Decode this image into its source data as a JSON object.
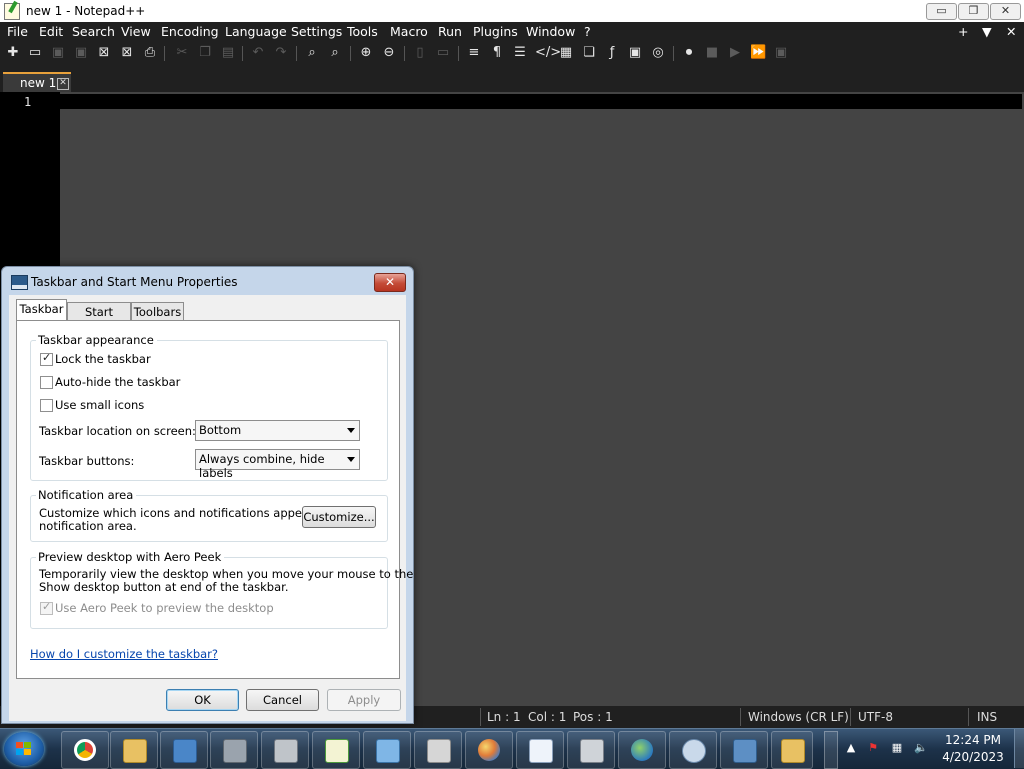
{
  "npp": {
    "title": "new 1 - Notepad++",
    "menu": [
      "File",
      "Edit",
      "Search",
      "View",
      "Encoding",
      "Language",
      "Settings",
      "Tools",
      "Macro",
      "Run",
      "Plugins",
      "Window",
      "?"
    ],
    "menu_right": {
      "plus": "+",
      "down": "▼",
      "close": "✕"
    },
    "window_buttons": {
      "minimize": "▭",
      "maximize": "❐",
      "close": "✕"
    },
    "tab": {
      "label": "new 1",
      "close": "✕"
    },
    "editor": {
      "line_number": "1"
    },
    "status": {
      "ln": "Ln : 1",
      "col": "Col : 1",
      "pos": "Pos : 1",
      "eol": "Windows (CR LF)",
      "encoding": "UTF-8",
      "mode": "INS"
    }
  },
  "dialog": {
    "title": "Taskbar and Start Menu Properties",
    "close": "✕",
    "tabs": [
      "Taskbar",
      "Start Menu",
      "Toolbars"
    ],
    "appearance": {
      "label": "Taskbar appearance",
      "lock": {
        "label": "Lock the taskbar",
        "checked": true
      },
      "autohide": {
        "label": "Auto-hide the taskbar",
        "checked": false
      },
      "small_icons": {
        "label": "Use small icons",
        "checked": false
      },
      "location_label": "Taskbar location on screen:",
      "location_value": "Bottom",
      "buttons_label": "Taskbar buttons:",
      "buttons_value": "Always combine, hide labels"
    },
    "notification": {
      "label": "Notification area",
      "line1": "Customize which icons and notifications appear in the",
      "line2": "notification area.",
      "customize": "Customize..."
    },
    "aero": {
      "label": "Preview desktop with Aero Peek",
      "line1": "Temporarily view the desktop when you move your mouse to the",
      "line2": "Show desktop button at end of the taskbar.",
      "checkbox": "Use Aero Peek to preview the desktop"
    },
    "help_link": "How do I customize the taskbar?",
    "ok": "OK",
    "cancel": "Cancel",
    "apply": "Apply"
  },
  "taskbar": {
    "time": "12:24 PM",
    "date": "4/20/2023",
    "tray_up": "▲"
  }
}
